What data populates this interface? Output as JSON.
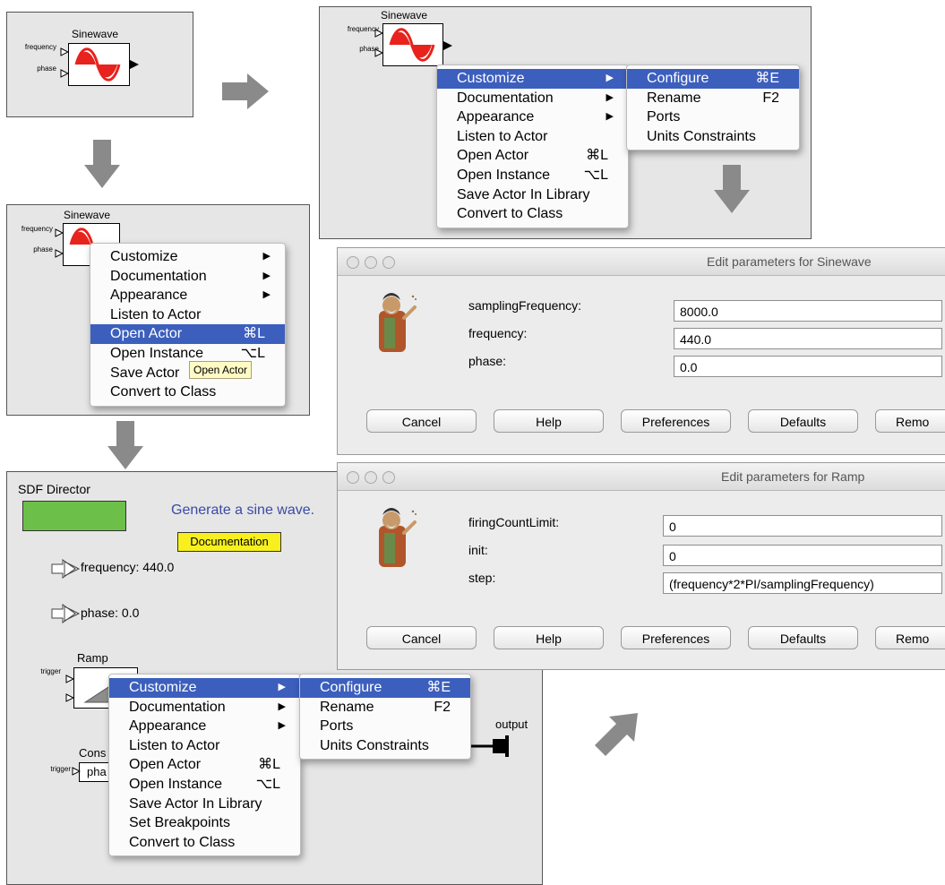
{
  "panel1": {
    "actor_title": "Sinewave",
    "port_frequency": "frequency",
    "port_phase": "phase"
  },
  "panel2": {
    "actor_title": "Sinewave",
    "port_frequency": "frequency",
    "port_phase": "phase",
    "menu": {
      "customize": "Customize",
      "documentation": "Documentation",
      "appearance": "Appearance",
      "listen": "Listen to Actor",
      "open_actor": "Open Actor",
      "open_actor_sc": "⌘L",
      "open_instance": "Open Instance",
      "open_instance_sc": "⌥L",
      "save_actor": "Save Actor In Library",
      "convert": "Convert to Class"
    },
    "submenu": {
      "configure": "Configure",
      "configure_sc": "⌘E",
      "rename": "Rename",
      "rename_sc": "F2",
      "ports": "Ports",
      "units": "Units Constraints"
    }
  },
  "panel3": {
    "actor_title": "Sinewave",
    "port_frequency": "frequency",
    "port_phase": "phase",
    "menu": {
      "customize": "Customize",
      "documentation": "Documentation",
      "appearance": "Appearance",
      "listen": "Listen to Actor",
      "open_actor": "Open Actor",
      "open_actor_sc": "⌘L",
      "open_instance": "Open Instance",
      "open_instance_sc": "⌥L",
      "save_actor": "Save Actor",
      "convert": "Convert to Class"
    },
    "tooltip": "Open Actor"
  },
  "panel4": {
    "director": "SDF Director",
    "annotation": "Generate a sine wave.",
    "doc_button": "Documentation",
    "param_frequency": "frequency: 440.0",
    "param_phase": "phase: 0.0",
    "ramp_title": "Ramp",
    "ramp_port": "trigger",
    "const_title": "Cons",
    "const_port": "trigger",
    "const_text": "pha",
    "output": "output",
    "menu": {
      "customize": "Customize",
      "documentation": "Documentation",
      "appearance": "Appearance",
      "listen": "Listen to Actor",
      "open_actor": "Open Actor",
      "open_actor_sc": "⌘L",
      "open_instance": "Open Instance",
      "open_instance_sc": "⌥L",
      "save_actor": "Save Actor In Library",
      "breakpoints": "Set Breakpoints",
      "convert": "Convert to Class"
    },
    "submenu": {
      "configure": "Configure",
      "configure_sc": "⌘E",
      "rename": "Rename",
      "rename_sc": "F2",
      "ports": "Ports",
      "units": "Units Constraints"
    }
  },
  "dialog_sinewave": {
    "title": "Edit parameters for Sinewave",
    "params": [
      {
        "label": "samplingFrequency:",
        "value": "8000.0"
      },
      {
        "label": "frequency:",
        "value": "440.0"
      },
      {
        "label": "phase:",
        "value": "0.0"
      }
    ],
    "buttons": {
      "cancel": "Cancel",
      "help": "Help",
      "preferences": "Preferences",
      "defaults": "Defaults",
      "remove": "Remo"
    }
  },
  "dialog_ramp": {
    "title": "Edit parameters for Ramp",
    "params": [
      {
        "label": "firingCountLimit:",
        "value": "0"
      },
      {
        "label": "init:",
        "value": "0"
      },
      {
        "label": "step:",
        "value": "(frequency*2*PI/samplingFrequency)"
      }
    ],
    "buttons": {
      "cancel": "Cancel",
      "help": "Help",
      "preferences": "Preferences",
      "defaults": "Defaults",
      "remove": "Remo"
    }
  },
  "colors": {
    "menu_highlight": "#3c5fbd",
    "sine_red": "#e8221c",
    "director_green": "#6cc04a",
    "annotation_blue": "#3a4aa8",
    "doc_yellow": "#f7f01e",
    "flow_arrow": "#8a8a8a"
  },
  "icons": [
    "flow-arrow-icon",
    "sine-wave-icon",
    "ramp-icon",
    "parameter-arrow-icon",
    "output-port-icon",
    "ptolemy-portrait-icon"
  ]
}
